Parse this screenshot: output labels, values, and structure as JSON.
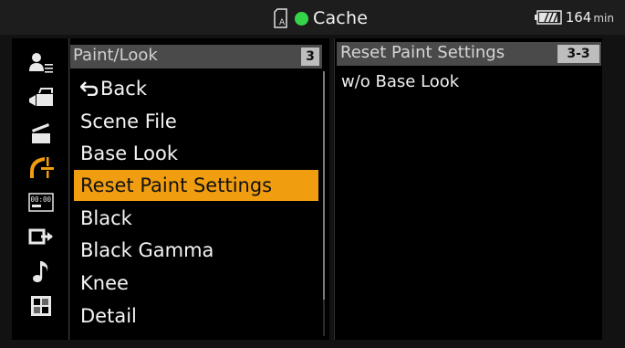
{
  "topbar": {
    "title": "Cache",
    "card_icon": "media-card-icon",
    "rec_indicator_color": "#35d44a",
    "battery_icon": "battery-icon",
    "battery_level": 0.9,
    "battery_minutes": "164",
    "battery_unit": "min"
  },
  "sidebar": {
    "icons": [
      {
        "name": "user-menu-icon",
        "active": false
      },
      {
        "name": "camera-icon",
        "active": false
      },
      {
        "name": "clapperboard-icon",
        "active": false
      },
      {
        "name": "paint-icon",
        "active": true
      },
      {
        "name": "timecode-icon",
        "active": false
      },
      {
        "name": "output-icon",
        "active": false
      },
      {
        "name": "audio-icon",
        "active": false
      },
      {
        "name": "grid-icon",
        "active": false
      }
    ],
    "active_color": "#f09d10"
  },
  "menu": {
    "title": "Paint/Look",
    "page_number": "3",
    "back_label": "Back",
    "items": [
      {
        "label": "Scene File"
      },
      {
        "label": "Base Look"
      },
      {
        "label": "Reset Paint Settings",
        "selected": true
      },
      {
        "label": "Black"
      },
      {
        "label": "Black Gamma"
      },
      {
        "label": "Knee"
      },
      {
        "label": "Detail"
      }
    ]
  },
  "detail": {
    "title": "Reset Paint Settings",
    "page_number": "3-3",
    "value": "w/o Base Look"
  }
}
